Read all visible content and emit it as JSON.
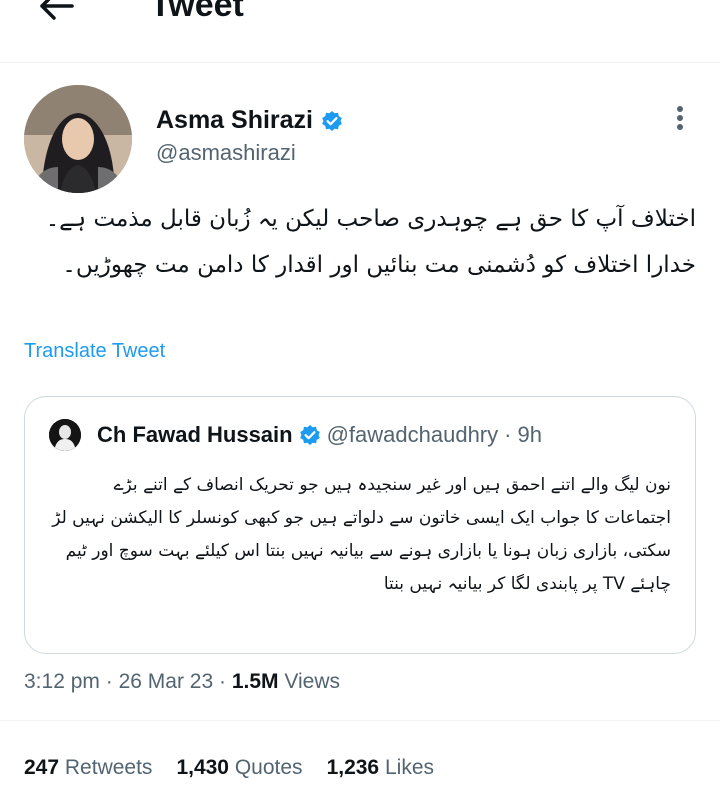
{
  "header": {
    "title": "Tweet",
    "back_icon": "arrow-left-icon"
  },
  "author": {
    "name": "Asma Shirazi",
    "handle": "@asmashirazi",
    "verified_icon": "verified-badge-icon",
    "more_icon": "more-vertical-icon"
  },
  "tweet": {
    "text": "اختلاف آپ کا حق ہے چوہدری صاحب لیکن یہ زُبان قابل مذمت ہے۔ خدارا اختلاف کو دُشمنی مت بنائیں اور اقدار کا دامن مت چھوڑیں۔",
    "translate_label": "Translate Tweet"
  },
  "quoted": {
    "name": "Ch Fawad Hussain",
    "handle": "@fawadchaudhry",
    "separator": "·",
    "time": "9h",
    "text": "نون لیگ والے اتنے احمق ہیں اور غیر سنجیدہ ہیں جو تحریک انصاف کے اتنے بڑے اجتماعات کا جواب ایک ایسی خاتون سے دلواتے ہیں جو کبھی کونسلر کا الیکشن نہیں لڑ سکتی، بازاری زبان ہونا یا بازاری ہونے سے بیانیہ نہیں بنتا اس کیلئے بہت سوچ اور ٹیم چاہئے TV پر پابندی لگا کر بیانیہ نہیں بنتا"
  },
  "meta": {
    "time": "3:12 pm",
    "sep": "·",
    "date": "26 Mar 23",
    "views_count": "1.5M",
    "views_label": "Views"
  },
  "stats": {
    "retweets_count": "247",
    "retweets_label": "Retweets",
    "quotes_count": "1,430",
    "quotes_label": "Quotes",
    "likes_count": "1,236",
    "likes_label": "Likes"
  },
  "colors": {
    "accent": "#1d9bf0",
    "text": "#0f1419",
    "muted": "#536471",
    "border": "#cfd9de"
  }
}
